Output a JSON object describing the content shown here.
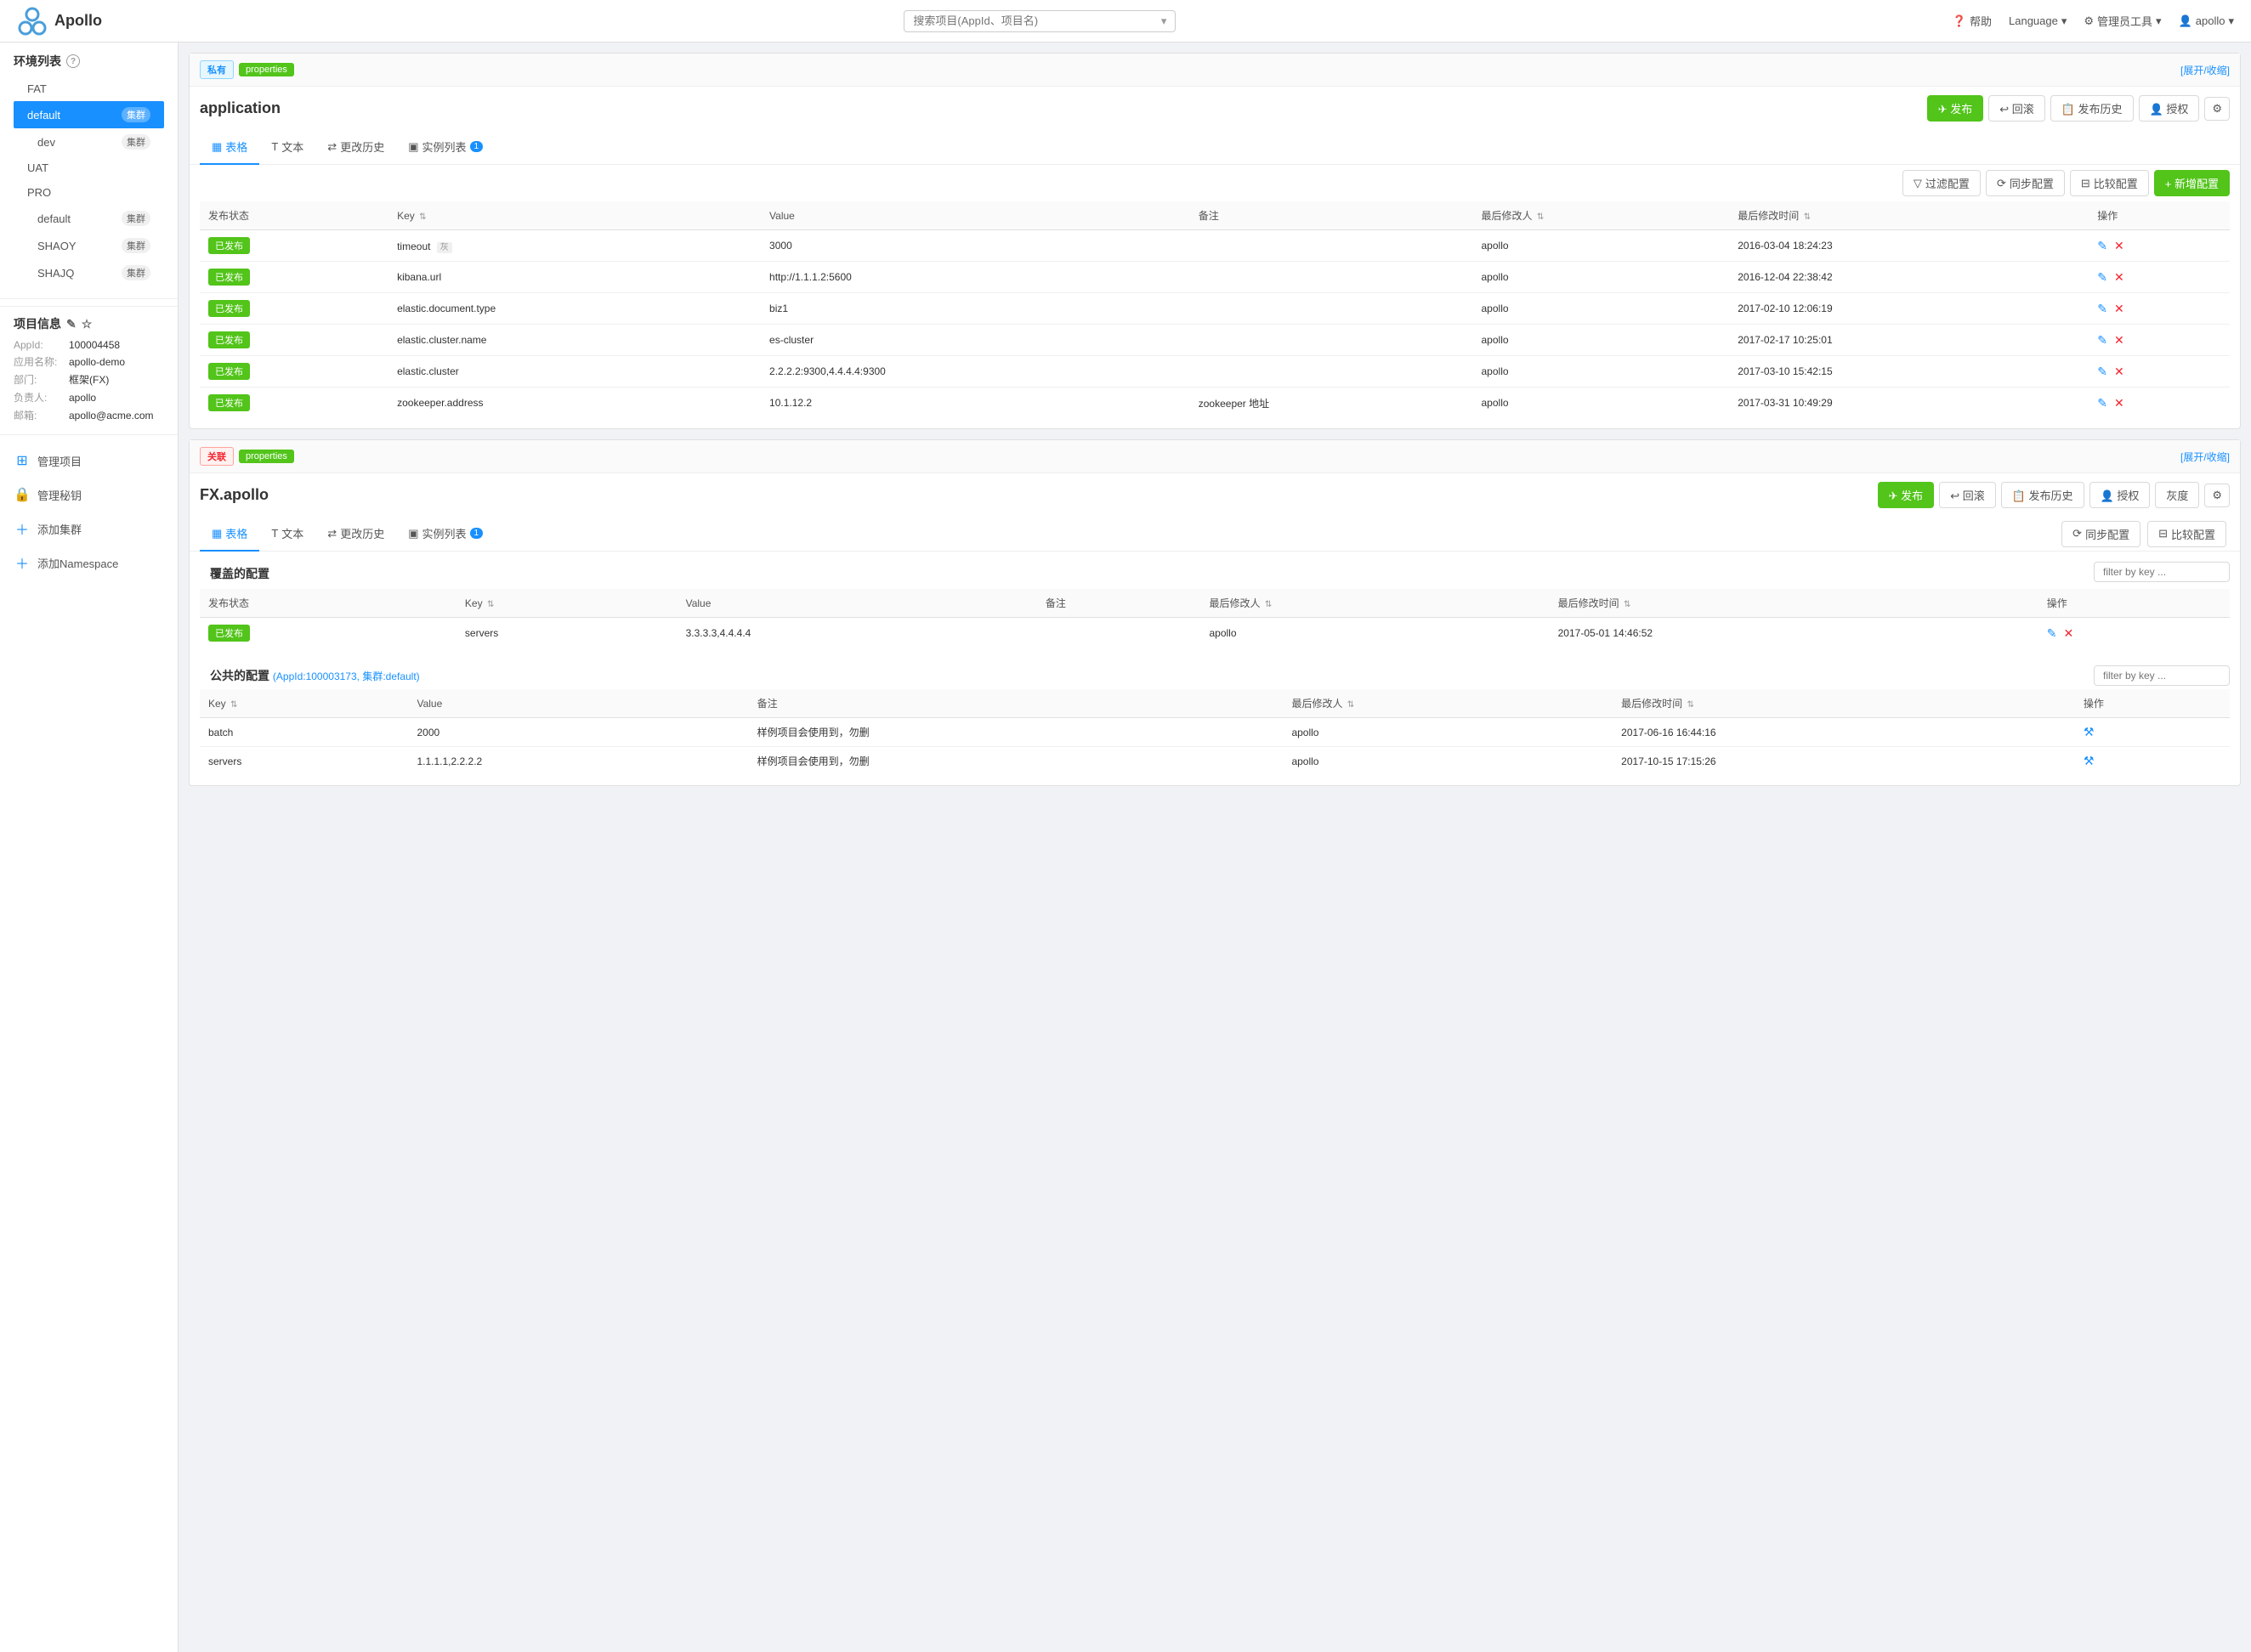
{
  "header": {
    "logo_text": "Apollo",
    "search_placeholder": "搜索项目(AppId、项目名)",
    "help_label": "帮助",
    "language_label": "Language",
    "admin_label": "管理员工具",
    "user_label": "apollo"
  },
  "sidebar": {
    "env_section_title": "环境列表",
    "envs": [
      {
        "name": "FAT",
        "cluster": false
      },
      {
        "name": "default",
        "cluster": true,
        "active": true
      },
      {
        "name": "dev",
        "cluster": true
      },
      {
        "name": "UAT",
        "cluster": false
      },
      {
        "name": "PRO",
        "cluster": false
      },
      {
        "name": "default",
        "cluster": true,
        "sub": true
      },
      {
        "name": "SHAOY",
        "cluster": true,
        "sub": true
      },
      {
        "name": "SHAJQ",
        "cluster": true,
        "sub": true
      }
    ],
    "project_section_title": "项目信息",
    "project": {
      "appid_label": "AppId:",
      "appid_value": "100004458",
      "appname_label": "应用名称:",
      "appname_value": "apollo-demo",
      "dept_label": "部门:",
      "dept_value": "框架(FX)",
      "owner_label": "负责人:",
      "owner_value": "apollo",
      "email_label": "邮箱:",
      "email_value": "apollo@acme.com"
    },
    "actions": [
      {
        "icon": "grid",
        "label": "管理项目"
      },
      {
        "icon": "lock",
        "label": "管理秘钥"
      },
      {
        "icon": "plus",
        "label": "添加集群"
      },
      {
        "icon": "plus",
        "label": "添加Namespace"
      }
    ]
  },
  "main": {
    "namespaces": [
      {
        "type": "private",
        "type_label": "私有",
        "tag_label": "properties",
        "expand_label": "[展开/收缩]",
        "title": "application",
        "tabs": [
          {
            "icon": "table",
            "label": "表格",
            "active": true
          },
          {
            "icon": "text",
            "label": "文本"
          },
          {
            "icon": "history",
            "label": "更改历史"
          },
          {
            "icon": "instance",
            "label": "实例列表",
            "badge": "1"
          }
        ],
        "actions": {
          "publish": "发布",
          "rollback": "回滚",
          "publish_history": "发布历史",
          "authorize": "授权",
          "settings": "⚙"
        },
        "table_toolbar": [
          {
            "label": "过滤配置",
            "icon": "filter"
          },
          {
            "label": "同步配置",
            "icon": "sync"
          },
          {
            "label": "比较配置",
            "icon": "compare"
          },
          {
            "label": "+ 新增配置",
            "primary": true
          }
        ],
        "columns": [
          "发布状态",
          "Key",
          "Value",
          "备注",
          "最后修改人",
          "最后修改时间",
          "操作"
        ],
        "rows": [
          {
            "status": "已发布",
            "key": "timeout",
            "gray_tag": "灰",
            "value": "3000",
            "note": "",
            "modifier": "apollo",
            "modified_time": "2016-03-04 18:24:23"
          },
          {
            "status": "已发布",
            "key": "kibana.url",
            "value": "http://1.1.1.2:5600",
            "note": "",
            "modifier": "apollo",
            "modified_time": "2016-12-04 22:38:42"
          },
          {
            "status": "已发布",
            "key": "elastic.document.type",
            "value": "biz1",
            "note": "",
            "modifier": "apollo",
            "modified_time": "2017-02-10 12:06:19"
          },
          {
            "status": "已发布",
            "key": "elastic.cluster.name",
            "value": "es-cluster",
            "note": "",
            "modifier": "apollo",
            "modified_time": "2017-02-17 10:25:01"
          },
          {
            "status": "已发布",
            "key": "elastic.cluster",
            "value": "2.2.2.2:9300,4.4.4.4:9300",
            "note": "",
            "modifier": "apollo",
            "modified_time": "2017-03-10 15:42:15"
          },
          {
            "status": "已发布",
            "key": "zookeeper.address",
            "value": "10.1.12.2",
            "note": "zookeeper 地址",
            "modifier": "apollo",
            "modified_time": "2017-03-31 10:49:29"
          }
        ]
      },
      {
        "type": "associated",
        "type_label": "关联",
        "tag_label": "properties",
        "expand_label": "[展开/收缩]",
        "title": "FX.apollo",
        "tabs": [
          {
            "icon": "table",
            "label": "表格",
            "active": true
          },
          {
            "icon": "text",
            "label": "文本"
          },
          {
            "icon": "history",
            "label": "更改历史"
          },
          {
            "icon": "instance",
            "label": "实例列表",
            "badge": "1"
          }
        ],
        "actions": {
          "publish": "发布",
          "rollback": "回滚",
          "publish_history": "发布历史",
          "authorize": "授权",
          "gray": "灰度",
          "settings": "⚙"
        },
        "table_toolbar_right": [
          {
            "label": "同步配置",
            "icon": "sync"
          },
          {
            "label": "比较配置",
            "icon": "compare"
          }
        ],
        "covered_section": {
          "label": "覆盖的配置",
          "filter_placeholder": "filter by key ..."
        },
        "covered_columns": [
          "发布状态",
          "Key",
          "Value",
          "备注",
          "最后修改人",
          "最后修改时间",
          "操作"
        ],
        "covered_rows": [
          {
            "status": "已发布",
            "key": "servers",
            "value": "3.3.3.3,4.4.4.4",
            "note": "",
            "modifier": "apollo",
            "modified_time": "2017-05-01 14:46:52"
          }
        ],
        "public_section": {
          "label": "公共的配置",
          "sub_info": "(AppId:100003173, 集群:default)",
          "filter_placeholder": "filter by key ..."
        },
        "public_columns": [
          "Key",
          "Value",
          "备注",
          "最后修改人",
          "最后修改时间",
          "操作"
        ],
        "public_rows": [
          {
            "key": "batch",
            "value": "2000",
            "note": "样例项目会使用到，勿删",
            "modifier": "apollo",
            "modified_time": "2017-06-16 16:44:16"
          },
          {
            "key": "servers",
            "value": "1.1.1.1,2.2.2.2",
            "note": "样例项目会使用到，勿删",
            "modifier": "apollo",
            "modified_time": "2017-10-15 17:15:26"
          }
        ]
      }
    ]
  }
}
